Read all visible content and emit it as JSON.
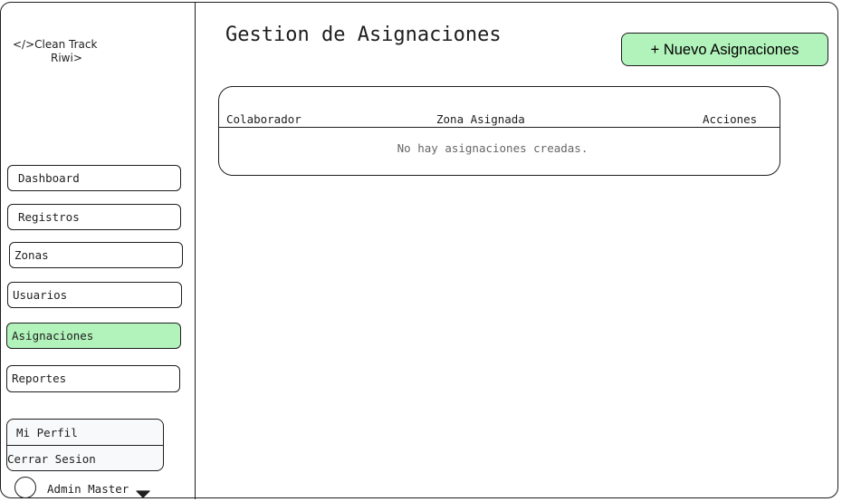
{
  "sidebar": {
    "logo_line1": "</>Clean Track",
    "logo_line2": "Riwi>",
    "nav": [
      {
        "label": "Dashboard",
        "active": false
      },
      {
        "label": "Registros",
        "active": false
      },
      {
        "label": "Zonas",
        "active": false
      },
      {
        "label": "Usuarios",
        "active": false
      },
      {
        "label": "Asignaciones",
        "active": true
      },
      {
        "label": "Reportes",
        "active": false
      }
    ],
    "profile_menu": {
      "my_profile": "Mi Perfil",
      "logout": "Cerrar Sesion"
    },
    "user": {
      "name": "Admin Master",
      "dropdown_icon": "caret-down-icon"
    }
  },
  "main": {
    "title": "Gestion de Asignaciones",
    "new_button_label": "+ Nuevo Asignaciones",
    "table": {
      "columns": [
        "Colaborador",
        "Zona Asignada",
        "Acciones"
      ],
      "rows": [],
      "empty_message": "No hay asignaciones creadas."
    }
  },
  "colors": {
    "accent": "#b2f2bb",
    "stroke": "#1e1e1e",
    "menu_background": "#f8f9fa",
    "muted_text": "#666666"
  }
}
